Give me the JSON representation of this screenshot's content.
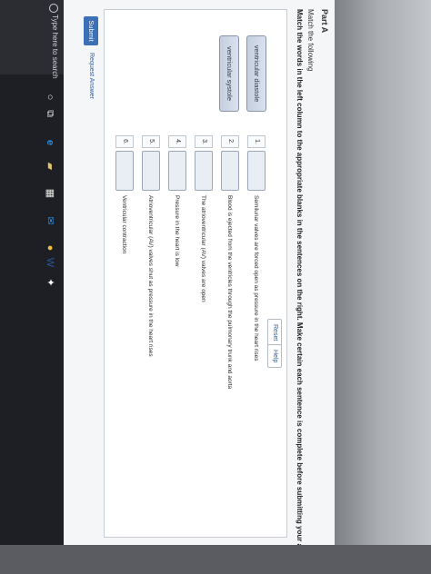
{
  "page": {
    "part_title": "Part A",
    "prompt_line1": "Match the following",
    "prompt_line2": "Match the words in the left column to the appropriate blanks in the sentences on the right. Make certain each sentence is complete before submitting your answer."
  },
  "toolbar": {
    "reset_label": "Reset",
    "help_label": "Help"
  },
  "word_bank": [
    {
      "label": "ventricular diastole"
    },
    {
      "label": "ventricular systole"
    }
  ],
  "sentences": [
    {
      "number": "1.",
      "text": "Semilunar valves are forced open as pressure in the heart rises"
    },
    {
      "number": "2.",
      "text": "Blood is ejected from the ventricles through the pulmonary trunk and aorta"
    },
    {
      "number": "3.",
      "text": "The atrioventricular (AV) valves are open"
    },
    {
      "number": "4.",
      "text": "Pressure in the heart is low"
    },
    {
      "number": "5.",
      "text": "Atrioventricular (AV) valves shut as pressure in the heart rises"
    },
    {
      "number": "6.",
      "text": "Ventricular contraction"
    }
  ],
  "actions": {
    "submit_label": "Submit",
    "request_answer_label": "Request Answer"
  },
  "taskbar": {
    "search_placeholder": "Type here to search",
    "icons": {
      "cortana": "○",
      "task_view": "⧉",
      "edge": "e",
      "files": "▰",
      "store": "▦",
      "mail": "✉",
      "dot": "●",
      "word": "W",
      "dropbox": "✦"
    }
  }
}
